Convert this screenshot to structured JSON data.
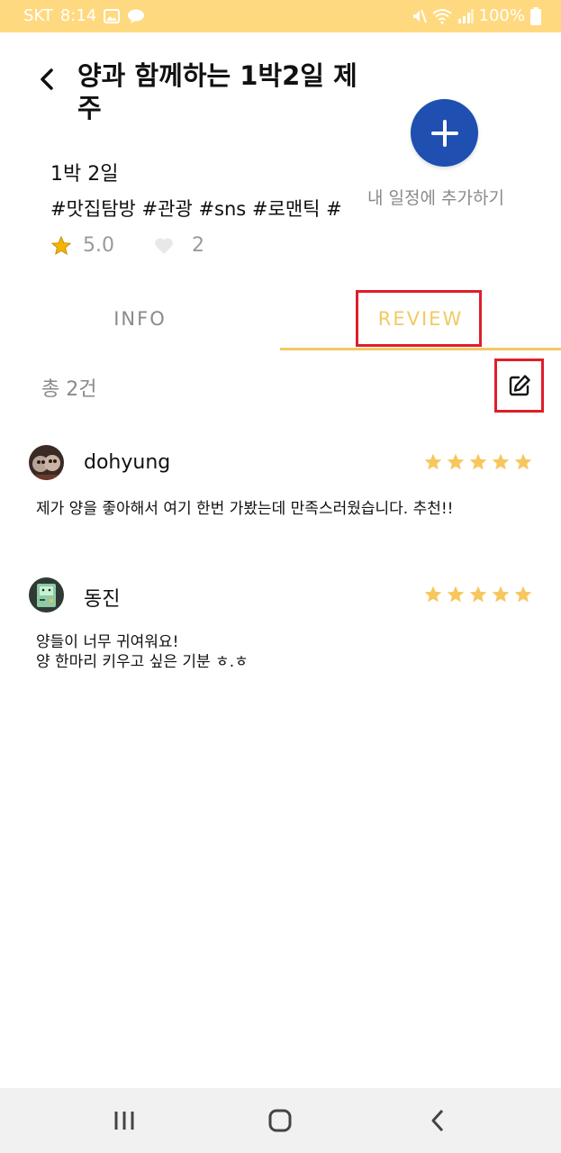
{
  "status_bar": {
    "carrier": "SKT",
    "time": "8:14",
    "battery": "100%",
    "icons": [
      "gallery-icon",
      "talk-icon",
      "mute-icon",
      "wifi-icon",
      "signal-icon",
      "battery-icon"
    ]
  },
  "header": {
    "title": "양과 함께하는 1박2일 제주"
  },
  "trip": {
    "duration": "1박 2일",
    "tags": "#맛집탐방 #관광 #sns #로맨틱 #",
    "rating": "5.0",
    "likes": "2"
  },
  "add_schedule": {
    "label": "내 일정에 추가하기"
  },
  "tabs": [
    {
      "label": "INFO",
      "active": false
    },
    {
      "label": "REVIEW",
      "active": true
    }
  ],
  "reviews_header": {
    "count": "총 2건"
  },
  "reviews": [
    {
      "name": "dohyung",
      "rating": 5,
      "text": "제가 양을 좋아해서 여기 한번 가봤는데 만족스러웠습니다. 추천!!"
    },
    {
      "name": "동진",
      "rating": 5,
      "text": "양들이 너무 귀여워요!\n양 한마리 키우고 싶은 기분 ㅎ.ㅎ"
    }
  ],
  "colors": {
    "accent_yellow": "#f2c964",
    "status_bar": "#ffd97f",
    "fab_blue": "#1e4fb1",
    "highlight_red": "#e01d2b"
  }
}
